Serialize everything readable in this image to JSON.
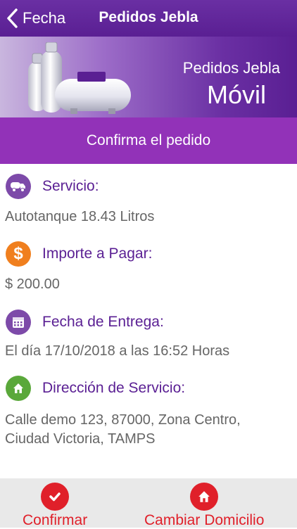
{
  "nav": {
    "back_label": "Fecha",
    "title": "Pedidos Jebla"
  },
  "banner": {
    "subtitle": "Pedidos Jebla",
    "title": "Móvil"
  },
  "confirm_bar": {
    "label": "Confirma el pedido"
  },
  "sections": {
    "service": {
      "label": "Servicio:",
      "value": "Autotanque 18.43 Litros",
      "icon": "truck-icon",
      "color": "#7d4aa9"
    },
    "amount": {
      "label": "Importe a Pagar:",
      "value": "$ 200.00",
      "icon": "dollar-icon",
      "color": "#f07f1e"
    },
    "delivery": {
      "label": "Fecha de Entrega:",
      "value": "El día 17/10/2018 a las 16:52 Horas",
      "icon": "calendar-icon",
      "color": "#7d4aa9"
    },
    "address": {
      "label": "Dirección de Servicio:",
      "value_line1": "Calle demo 123, 87000, Zona Centro,",
      "value_line2": "Ciudad Victoria, TAMPS",
      "icon": "home-icon",
      "color": "#5aa83a"
    }
  },
  "footer": {
    "confirm": {
      "label": "Confirmar",
      "icon": "check-icon"
    },
    "change_address": {
      "label": "Cambiar Domicilio",
      "icon": "home-icon"
    },
    "color": "#e0202a"
  },
  "colors": {
    "primary": "#5a1f93",
    "accent": "#9232b8"
  }
}
